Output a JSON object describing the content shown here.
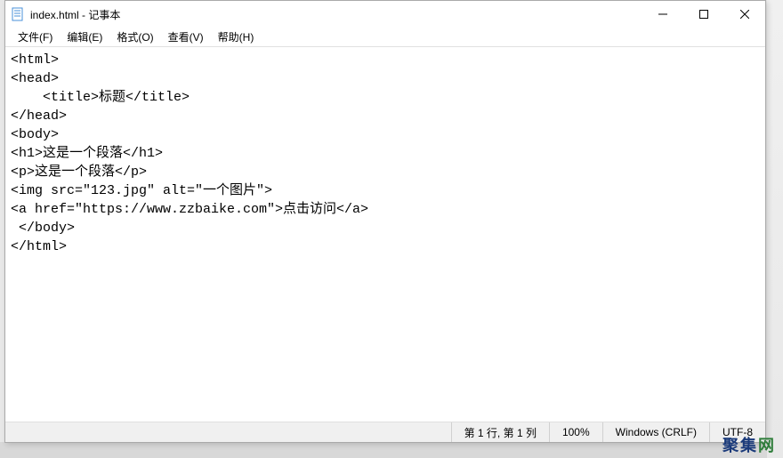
{
  "titlebar": {
    "title": "index.html - 记事本"
  },
  "menu": {
    "file": "文件(F)",
    "edit": "编辑(E)",
    "format": "格式(O)",
    "view": "查看(V)",
    "help": "帮助(H)"
  },
  "content": {
    "lines": [
      "<html>",
      "<head>",
      "    <title>标题</title>",
      "</head>",
      "<body>",
      "<h1>这是一个段落</h1>",
      "<p>这是一个段落</p>",
      "<img src=\"123.jpg\" alt=\"一个图片\">",
      "<a href=\"https://www.zzbaike.com\">点击访问</a>",
      " </body>",
      "</html>"
    ]
  },
  "statusbar": {
    "position": "第 1 行, 第 1 列",
    "zoom": "100%",
    "line_ending": "Windows (CRLF)",
    "encoding": "UTF-8"
  },
  "watermark": {
    "text1": "聚集",
    "text2": "网"
  }
}
